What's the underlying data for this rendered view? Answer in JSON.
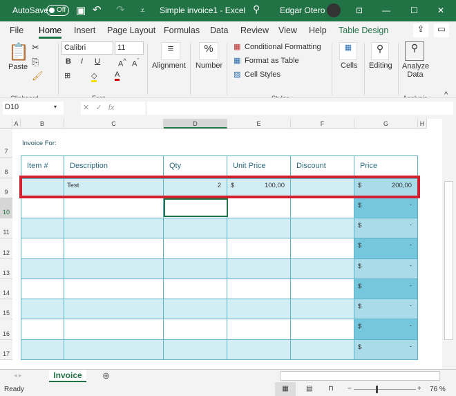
{
  "titlebar": {
    "autosave_label": "AutoSave",
    "autosave_state": "Off",
    "title": "Simple invoice1  -  Excel",
    "user": "Edgar Otero"
  },
  "tabs": [
    "File",
    "Home",
    "Insert",
    "Page Layout",
    "Formulas",
    "Data",
    "Review",
    "View",
    "Help",
    "Table Design"
  ],
  "ribbon": {
    "paste": "Paste",
    "clipboard": "Clipboard",
    "font_name": "Calibri",
    "font_size": "11",
    "font": "Font",
    "bold": "B",
    "italic": "I",
    "underline": "U",
    "alignment": "Alignment",
    "number": "Number",
    "number_icon": "%",
    "conditional_formatting": "Conditional Formatting",
    "format_as_table": "Format as Table",
    "cell_styles": "Cell Styles",
    "styles": "Styles",
    "cells": "Cells",
    "editing": "Editing",
    "analyze_data": "Analyze Data",
    "analysis": "Analysis"
  },
  "formula_bar": {
    "name_box": "D10",
    "fx": "fx",
    "value": ""
  },
  "columns": [
    "A",
    "B",
    "C",
    "D",
    "E",
    "F",
    "G",
    "H"
  ],
  "rows": [
    "7",
    "8",
    "9",
    "10",
    "11",
    "12",
    "13",
    "14",
    "15",
    "16",
    "17"
  ],
  "sheet": {
    "invoice_for": "Invoice For:",
    "headers": [
      "Item #",
      "Description",
      "Qty",
      "Unit Price",
      "Discount",
      "Price"
    ],
    "data_rows": [
      {
        "item": "",
        "description": "Test",
        "qty": "2",
        "unit_currency": "$",
        "unit_price": "100,00",
        "discount": "",
        "price_currency": "$",
        "price": "200,00"
      },
      {
        "price_currency": "$",
        "price": "-"
      },
      {
        "price_currency": "$",
        "price": "-"
      },
      {
        "price_currency": "$",
        "price": "-"
      },
      {
        "price_currency": "$",
        "price": "-"
      },
      {
        "price_currency": "$",
        "price": "-"
      },
      {
        "price_currency": "$",
        "price": "-"
      },
      {
        "price_currency": "$",
        "price": "-"
      },
      {
        "price_currency": "$",
        "price": "-"
      }
    ]
  },
  "sheet_tabs": [
    "Invoice"
  ],
  "status": {
    "text": "Ready",
    "zoom": "76 %"
  },
  "colors": {
    "accent": "#217346",
    "highlight": "#d32030",
    "band": "#d3edf4",
    "price_light": "#a9dbe8",
    "price_dark": "#74c7dc"
  }
}
